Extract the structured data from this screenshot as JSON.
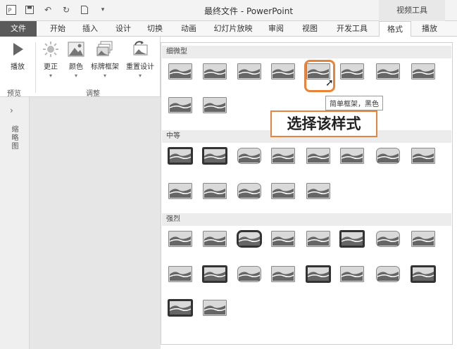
{
  "titlebar": {
    "app_title": "最终文件 - PowerPoint",
    "video_tools": "视频工具"
  },
  "tabs": [
    {
      "label": "文件"
    },
    {
      "label": "开始"
    },
    {
      "label": "插入"
    },
    {
      "label": "设计"
    },
    {
      "label": "切换"
    },
    {
      "label": "动画"
    },
    {
      "label": "幻灯片放映"
    },
    {
      "label": "审阅"
    },
    {
      "label": "视图"
    },
    {
      "label": "开发工具"
    },
    {
      "label": "格式"
    },
    {
      "label": "播放"
    }
  ],
  "ribbon": {
    "buttons": [
      "播放",
      "更正",
      "颜色",
      "标牌框架",
      "重置设计"
    ],
    "groups": [
      "预览",
      "调整"
    ]
  },
  "left_panel": {
    "vertical_label": "缩略图"
  },
  "gallery": {
    "categories": [
      "细微型",
      "中等",
      "强烈"
    ]
  },
  "tooltip": "简单框架，黑色",
  "callout": "选择该样式",
  "colors": {
    "accent": "#e8833a",
    "file_tab": "#5a5a5a"
  }
}
